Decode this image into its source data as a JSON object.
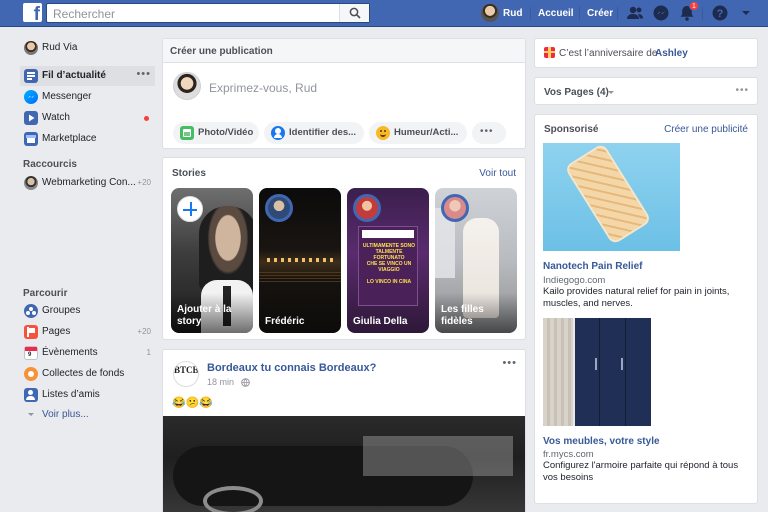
{
  "topbar": {
    "logo": "f",
    "search_placeholder": "Rechercher",
    "user_name": "Rud",
    "home": "Accueil",
    "create": "Créer",
    "notifications_count": "1",
    "brand_color": "#4267b2"
  },
  "leftnav": {
    "profile": "Rud Via",
    "items": [
      {
        "label": "Fil d’actualité",
        "icon": "news-feed-icon"
      },
      {
        "label": "Messenger",
        "icon": "messenger-icon"
      },
      {
        "label": "Watch",
        "icon": "watch-icon"
      },
      {
        "label": "Marketplace",
        "icon": "marketplace-icon"
      }
    ],
    "shortcuts_title": "Raccourcis",
    "shortcut": {
      "label": "Webmarketing Con...",
      "count": "+20"
    },
    "explore_title": "Parcourir",
    "explore": [
      {
        "label": "Groupes",
        "count": ""
      },
      {
        "label": "Pages",
        "count": "+20"
      },
      {
        "label": "Évènements",
        "count": "1"
      },
      {
        "label": "Collectes de fonds",
        "count": ""
      },
      {
        "label": "Listes d’amis",
        "count": ""
      }
    ],
    "see_more": "Voir plus..."
  },
  "composer": {
    "title": "Créer une publication",
    "placeholder": "Exprimez-vous, Rud",
    "actions": [
      "Photo/Vidéo",
      "Identifier des...",
      "Humeur/Acti..."
    ]
  },
  "stories": {
    "title": "Stories",
    "see_all": "Voir tout",
    "items": [
      {
        "label": "Ajouter à la story"
      },
      {
        "label": "Frédéric"
      },
      {
        "label": "Giulia Della"
      },
      {
        "label": "Les filles fidèles"
      }
    ],
    "story3_lines": [
      "ULTIMAMENTE SONO TALMENTE FORTUNATO",
      "CHE SE VINCO UN VIAGGIO",
      "LO VINCO IN CINA"
    ]
  },
  "post": {
    "author": "Bordeaux tu connais Bordeaux?",
    "time": "18 min",
    "emojis": "😂😕😂",
    "avatar_text": "BTCB"
  },
  "rightcol": {
    "birthday_prefix": "C’est l’anniversaire de ",
    "birthday_name": "Ashley",
    "pages_title": "Vos Pages (4)",
    "sponsored": "Sponsorisé",
    "create_ad": "Créer une publicité",
    "ads": [
      {
        "title": "Nanotech Pain Relief",
        "url": "Indiegogo.com",
        "desc": "Kailo provides natural relief for pain in joints, muscles, and nerves."
      },
      {
        "title": "Vos meubles, votre style",
        "url": "fr.mycs.com",
        "desc": "Configurez l'armoire parfaite qui répond à tous vos besoins"
      }
    ]
  }
}
